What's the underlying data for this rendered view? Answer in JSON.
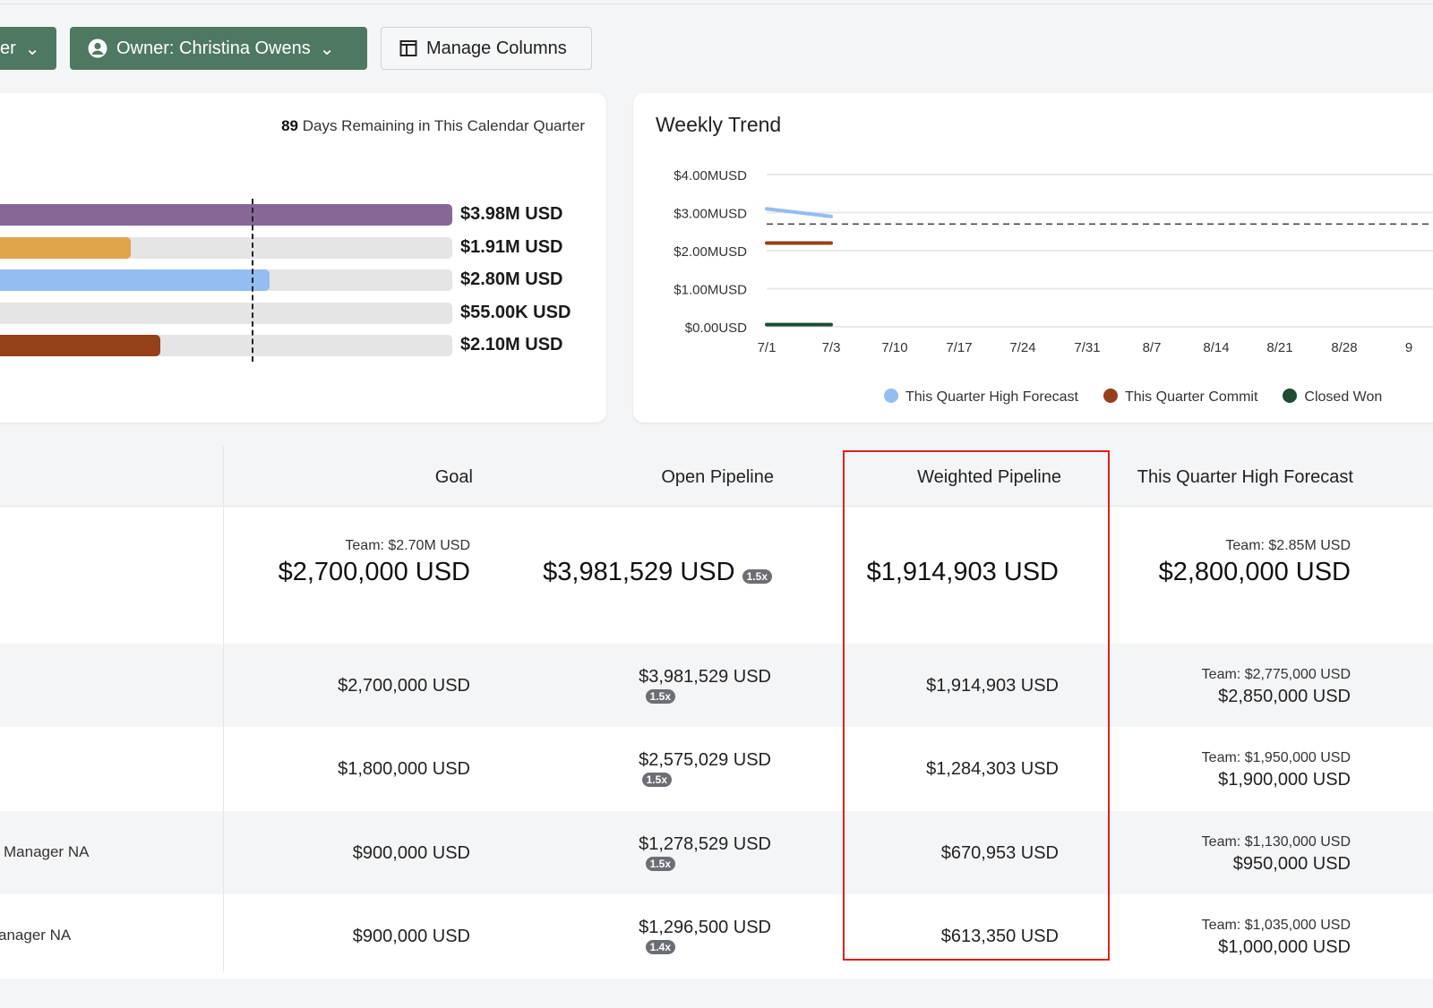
{
  "toolbar": {
    "filter_partial": "er",
    "owner_button": "Owner: Christina Owens",
    "manage_columns": "Manage Columns"
  },
  "progress": {
    "days_number": "89",
    "days_text": " Days Remaining in This Calendar Quarter",
    "bars": [
      {
        "label": "$3.98M USD",
        "value_m": 3.98,
        "color": "#876796"
      },
      {
        "label": "$1.91M USD",
        "value_m": 1.91,
        "color": "#e0a54b"
      },
      {
        "label": "$2.80M USD",
        "value_m": 2.8,
        "color": "#94bdf2"
      },
      {
        "label": "$55.00K USD",
        "value_m": 0.055,
        "color": "#e5e5e6"
      },
      {
        "label": "$2.10M USD",
        "value_m": 2.1,
        "color": "#96401a"
      }
    ],
    "goal_m": 2.7
  },
  "chart_data": {
    "type": "line",
    "title": "Weekly Trend",
    "y_ticks": [
      "$4.00MUSD",
      "$3.00MUSD",
      "$2.00MUSD",
      "$1.00MUSD",
      "$0.00USD"
    ],
    "ylim": [
      0,
      4
    ],
    "x_ticks": [
      "7/1",
      "7/3",
      "7/10",
      "7/17",
      "7/24",
      "7/31",
      "8/7",
      "8/14",
      "8/21",
      "8/28",
      "9"
    ],
    "goal_line_m": 2.7,
    "series": [
      {
        "name": "This Quarter High Forecast",
        "color": "#94bdf2",
        "values": [
          3.1,
          2.9
        ]
      },
      {
        "name": "This Quarter Commit",
        "color": "#96401a",
        "values": [
          2.2,
          2.2
        ]
      },
      {
        "name": "Closed Won",
        "color": "#1d4d32",
        "values": [
          0.055,
          0.055
        ]
      }
    ],
    "legend": "bottom"
  },
  "table": {
    "headers": [
      "Goal",
      "Open Pipeline",
      "Weighted Pipeline",
      "This Quarter High Forecast"
    ],
    "summary": {
      "goal_team": "Team: $2.70M USD",
      "goal": "$2,700,000 USD",
      "open": "$3,981,529 USD",
      "open_badge": "1.5x",
      "weighted": "$1,914,903 USD",
      "hf_team": "Team: $2.85M USD",
      "hf": "$2,800,000 USD"
    },
    "rows": [
      {
        "name": "",
        "goal": "$2,700,000 USD",
        "open": "$3,981,529 USD",
        "badge": "1.5x",
        "weighted": "$1,914,903 USD",
        "hf_team": "Team: $2,775,000 USD",
        "hf": "$2,850,000 USD"
      },
      {
        "name": "",
        "goal": "$1,800,000 USD",
        "open": "$2,575,029 USD",
        "badge": "1.5x",
        "weighted": "$1,284,303 USD",
        "hf_team": "Team: $1,950,000 USD",
        "hf": "$1,900,000 USD"
      },
      {
        "name": "Manager NA",
        "goal": "$900,000 USD",
        "open": "$1,278,529 USD",
        "badge": "1.5x",
        "weighted": "$670,953 USD",
        "hf_team": "Team: $1,130,000 USD",
        "hf": "$950,000 USD"
      },
      {
        "name": "anager NA",
        "goal": "$900,000 USD",
        "open": "$1,296,500 USD",
        "badge": "1.4x",
        "weighted": "$613,350 USD",
        "hf_team": "Team: $1,035,000 USD",
        "hf": "$1,000,000 USD"
      }
    ]
  }
}
